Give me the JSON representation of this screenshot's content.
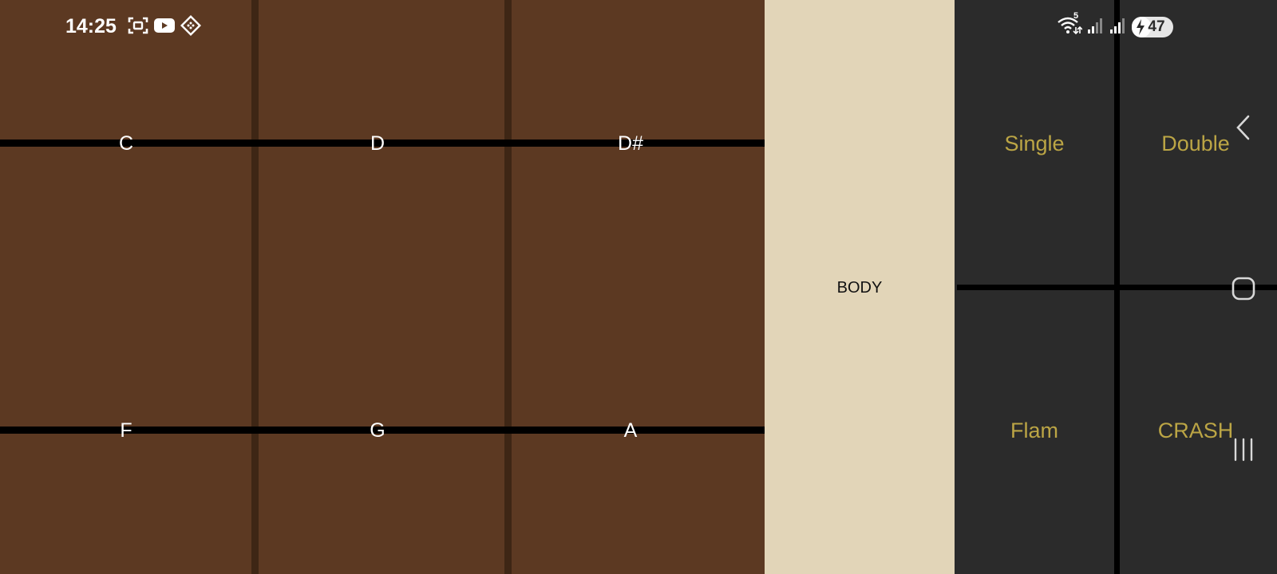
{
  "status_bar": {
    "time": "14:25",
    "left_icons": [
      "screenshot-icon",
      "youtube-icon",
      "app-icon"
    ],
    "right_icons": [
      "wifi-icon",
      "signal-icon",
      "signal-icon-2"
    ],
    "wifi_label": "5",
    "battery_level": "47",
    "battery_fraction": 0.47
  },
  "fretboard": {
    "top_row": [
      "C",
      "D",
      "D#"
    ],
    "bottom_row": [
      "F",
      "G",
      "A"
    ],
    "colors": {
      "wood": "#5c3922",
      "fret": "#3e2615",
      "string": "#000000",
      "note": "#ffffff"
    }
  },
  "body_panel": {
    "label": "BODY",
    "color": "#e2d5b8"
  },
  "drum_pads": {
    "top_left": "Single",
    "top_right": "Double",
    "bottom_left": "Flam",
    "bottom_right": "CRASH",
    "label_color": "#bba545"
  },
  "nav": {
    "back": "back-icon",
    "home": "home-icon",
    "recents": "recents-icon"
  }
}
